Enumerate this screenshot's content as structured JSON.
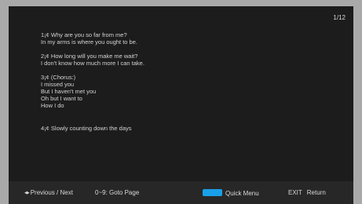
{
  "page_indicator": "1/12",
  "stanzas": [
    {
      "lines": [
        "1¡¢ Why are you so far from me?",
        "In my arms is where you ought to be."
      ]
    },
    {
      "lines": [
        "2¡¢ How long will you make me wait?",
        "I don't know how much more I can take."
      ]
    },
    {
      "lines": [
        "3¡¢ (Chorus:)",
        "I missed you",
        "But I haven't met you",
        "Oh but I want to",
        "How I do"
      ]
    },
    {
      "lines": [
        "4¡¢ Slowly counting down the days"
      ]
    }
  ],
  "footer": {
    "nav_label": "Previous / Next",
    "goto_label": "0~9: Goto Page",
    "quick_menu_label": "Quick Menu",
    "exit_key": "EXIT",
    "exit_label": "Return",
    "blue_key_color": "#19a0e8"
  }
}
